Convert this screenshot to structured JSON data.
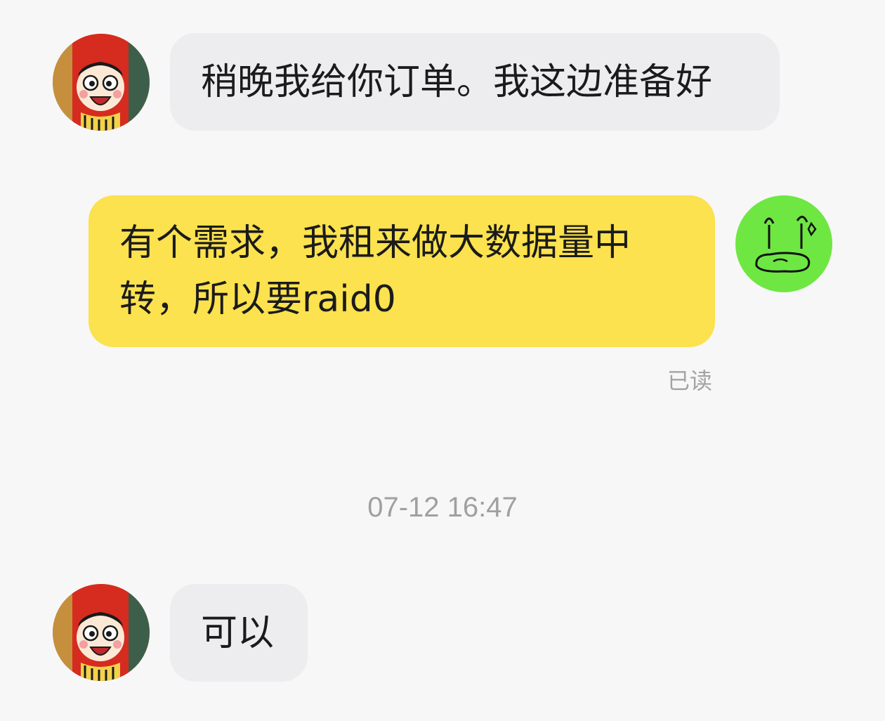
{
  "messages": [
    {
      "direction": "incoming",
      "sender_avatar": "cartoon-boy-avatar",
      "text": "稍晚我给你订单。我这边准备好"
    },
    {
      "direction": "outgoing",
      "sender_avatar": "doodle-face-avatar",
      "lines": [
        "有个需求，我租来做大数据量中",
        "转，所以要raid0"
      ]
    },
    {
      "direction": "incoming",
      "sender_avatar": "cartoon-boy-avatar",
      "text": "可以"
    }
  ],
  "read_status": "已读",
  "timestamp": "07-12 16:47",
  "colors": {
    "background": "#f7f7f7",
    "incoming_bubble": "#ededef",
    "outgoing_bubble": "#fbe24e",
    "outgoing_avatar_bg": "#6ee743",
    "meta_text": "#a3a3a3"
  }
}
